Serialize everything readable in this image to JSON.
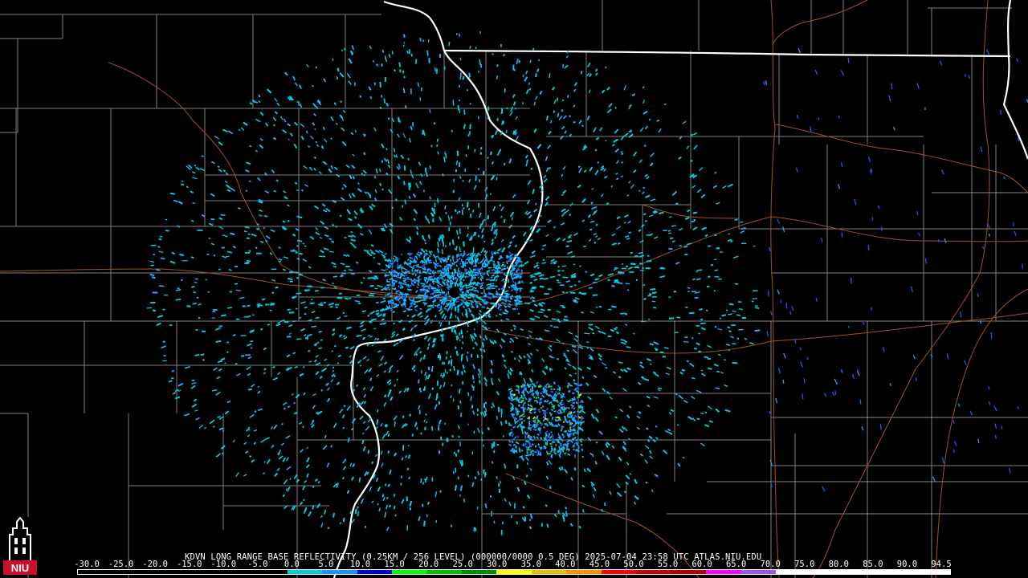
{
  "product": {
    "radar_id": "KDVN",
    "text": "KDVN LONG RANGE BASE REFLECTIVITY (0.25KM / 256 LEVEL) (000000/0000 0.5 DEG) 2025-07-04 23:58 UTC  ATLAS.NIU.EDU",
    "timestamp": "2025-07-04 23:58 UTC",
    "source": "ATLAS.NIU.EDU",
    "elevation": "0.5 DEG"
  },
  "logo": {
    "text": "NIU",
    "icon": "niu-tower-logo-icon",
    "color": "#c8102e"
  },
  "scale": {
    "labels": [
      "-30.0",
      "-25.0",
      "-20.0",
      "-15.0",
      "-10.0",
      "-5.0",
      "0.0",
      "5.0",
      "10.0",
      "15.0",
      "20.0",
      "25.0",
      "30.0",
      "35.0",
      "40.0",
      "45.0",
      "50.0",
      "55.0",
      "60.0",
      "65.0",
      "70.0",
      "75.0",
      "80.0",
      "85.0",
      "90.0",
      "94.5"
    ],
    "colors": [
      "#000000",
      "#000000",
      "#000000",
      "#000000",
      "#000000",
      "#000000",
      "#00cfd8",
      "#1e90ff",
      "#0000e0",
      "#00ff00",
      "#00c000",
      "#008c00",
      "#ffff00",
      "#e8c000",
      "#ff9000",
      "#ff0000",
      "#d00000",
      "#b00000",
      "#ff00ff",
      "#9955ee",
      "#ffffff",
      "#ffffff",
      "#ffffff",
      "#ffffff",
      "#ffffff"
    ]
  },
  "map": {
    "background": "#000000",
    "state_border_color": "#ffffff",
    "county_border_color": "#7f7f7f",
    "highway_color": "#a0522d",
    "echo_colors": [
      "#00cfe0",
      "#1ec8f0",
      "#22a6ff",
      "#1a5cff",
      "#16e030",
      "#e6f000"
    ],
    "radar_site_color": "#000000"
  }
}
